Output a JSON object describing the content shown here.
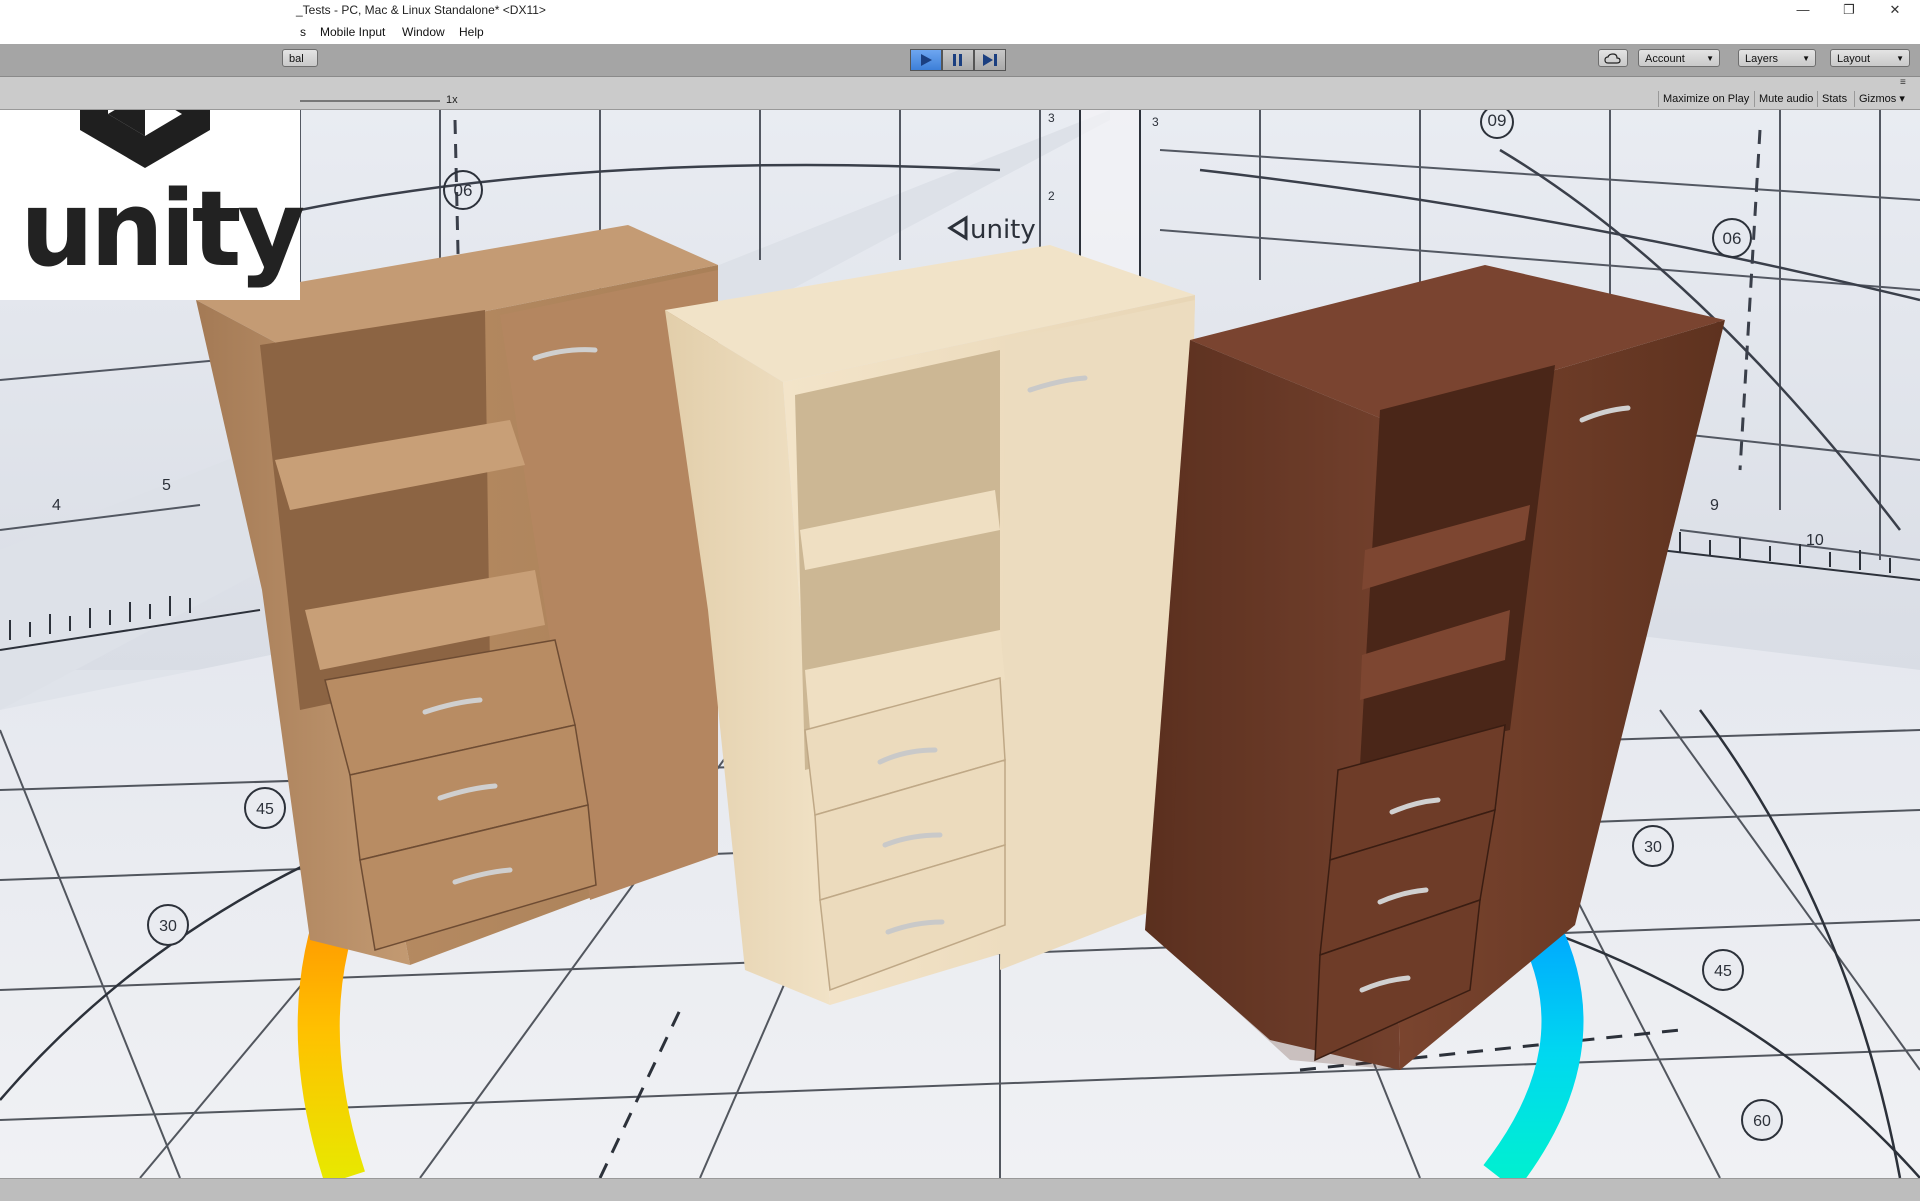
{
  "window": {
    "title": "_Tests - PC, Mac & Linux Standalone* <DX11>",
    "minimize_glyph": "—",
    "restore_glyph": "❐",
    "close_glyph": "✕"
  },
  "menu": {
    "items": [
      "s",
      "Mobile Input",
      "Window",
      "Help"
    ]
  },
  "toolbar": {
    "left_fragment": "bal",
    "account_label": "Account",
    "layers_label": "Layers",
    "layout_label": "Layout",
    "cloud_icon": "cloud-icon"
  },
  "gamebar": {
    "scale_label": "1x",
    "maximize_label": "Maximize on Play",
    "mute_label": "Mute audio",
    "stats_label": "Stats",
    "gizmos_label": "Gizmos"
  },
  "scene": {
    "backdrop_logo_text": "unity",
    "floor_labels": [
      "06",
      "06",
      "09",
      "45",
      "30",
      "30",
      "45",
      "60"
    ],
    "ruler_numbers": [
      "3",
      "2",
      "3",
      "4",
      "5",
      "9",
      "10"
    ]
  },
  "logo": {
    "text": "unity"
  },
  "colors": {
    "accent_play": "#4a8be0",
    "toolbar_bg": "#a5a5a5",
    "cabinet_light_oak": "#b58a62",
    "cabinet_maple": "#efdcbc",
    "cabinet_walnut": "#6b3a26",
    "arc_warm": "#ffa200",
    "arc_cool": "#00c8f0"
  }
}
